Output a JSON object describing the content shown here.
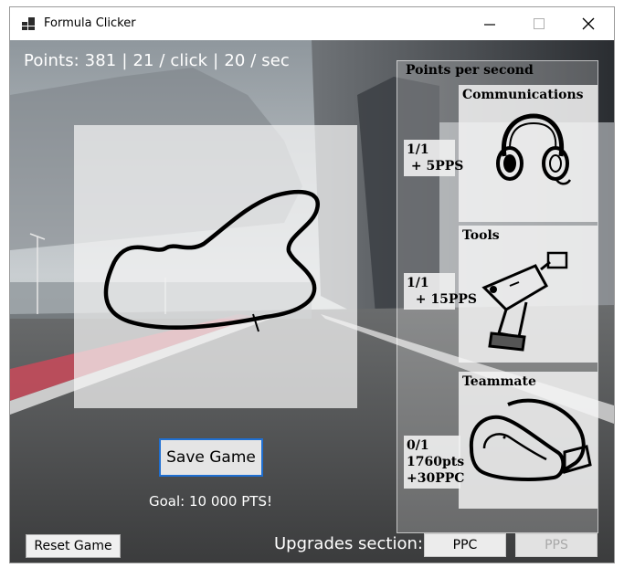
{
  "window": {
    "title": "Formula Clicker"
  },
  "stats": {
    "points": "Points: 381",
    "per_click": "21 / click",
    "per_sec": "20 / sec",
    "sep": "|"
  },
  "main": {
    "save_label": "Save Game",
    "goal_text": "Goal: 10 000 PTS!",
    "reset_label": "Reset Game",
    "upgrades_label": "Upgrades section:",
    "tab_ppc": "PPC",
    "tab_pps": "PPS"
  },
  "pps_panel": {
    "title": "Points per second",
    "upgrades": [
      {
        "name": "Communications",
        "owned": "1/1",
        "effect": "+ 5PPS",
        "icon": "headset-icon"
      },
      {
        "name": "Tools",
        "owned": "1/1",
        "effect": "+ 15PPS",
        "icon": "drill-icon"
      },
      {
        "name": "Teammate",
        "owned": "0/1",
        "cost": "1760pts",
        "effect": "+30PPC",
        "icon": "gloves-icon"
      }
    ]
  },
  "colors": {
    "accent": "#1f6fd1",
    "stat_text": "#ffffff",
    "disabled_text": "#a8a8a8"
  }
}
